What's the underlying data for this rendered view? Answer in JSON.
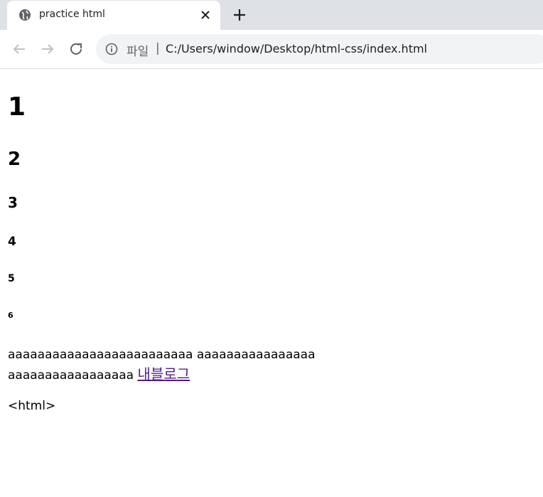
{
  "browser": {
    "tab": {
      "title": "practice html",
      "icon": "globe-icon"
    },
    "address": {
      "security_chip": "파일",
      "separator": "|",
      "url": "C:/Users/window/Desktop/html-css/index.html"
    }
  },
  "page": {
    "headings": [
      "1",
      "2",
      "3",
      "4",
      "5",
      "6"
    ],
    "paragraph": {
      "text": "aaaaaaaaaaaaaaaaaaaaaaaaa aaaaaaaaaaaaaaaa aaaaaaaaaaaaaaaaa",
      "link_text": "내블로그"
    },
    "code_text": "<html>"
  },
  "colors": {
    "tab_strip": "#dee1e6",
    "link_visited": "#551a8b",
    "omnibox": "#f1f3f4"
  }
}
